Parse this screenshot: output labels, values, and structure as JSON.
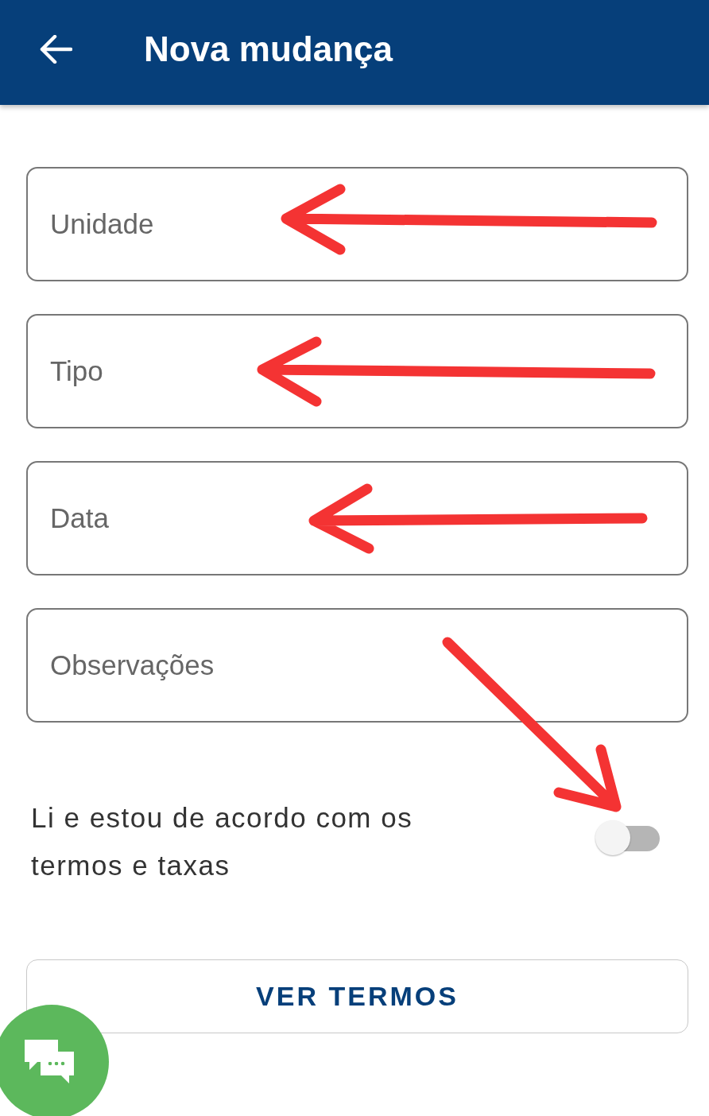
{
  "app_bar": {
    "title": "Nova mudança"
  },
  "fields": [
    {
      "placeholder": "Unidade"
    },
    {
      "placeholder": "Tipo"
    },
    {
      "placeholder": "Data"
    },
    {
      "placeholder": "Observações"
    }
  ],
  "agreement": {
    "label": "Li e estou de acordo com os termos e taxas",
    "on": false
  },
  "buttons": [
    {
      "label": "VER TERMOS"
    }
  ]
}
